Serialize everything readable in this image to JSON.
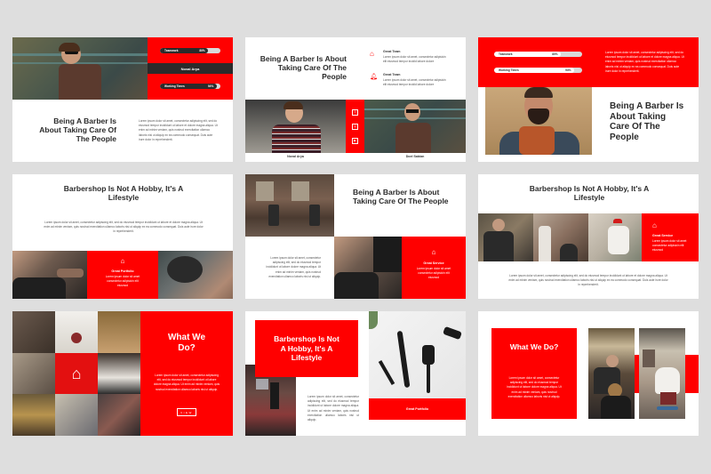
{
  "colors": {
    "accent": "#ff0000",
    "dark": "#2a2a2a",
    "heading": "#2b2b2b",
    "background": "#dedede"
  },
  "lorem": {
    "long": "Lorem ipsum dolor sit amet, consectetur adipiscing elit, sed do eiusmod tempor incididunt ut labore et dolore magna aliqua. Ut enim ad minim veniam, quis nostrud exercitation ullamco laboris nisi ut aliquip ex ea commodo consequat. Duis aute irure dolor in reprehenderit.",
    "medium": "Lorem ipsum dolor sit amet, consectetur adipiscing elit, sed do eiusmod tempor incididunt ut labore dolore magna aliqua. Ut enim ad minim veniam, quis nostrud exercitation ullamco laboris nisi ut aliquip.",
    "short": "Lorem ipsum dolor sit amet consectetur adipisicin elit eiusmod",
    "tiny": "Lorem ipsum dolor sit amet consectetur adipisicin elit eiusmod"
  },
  "slides": [
    {
      "title": "Being A Barber Is About Taking Care Of The People",
      "name_label": "Noval Arya",
      "skills": [
        {
          "label": "Teamwork",
          "percent": 80,
          "percent_text": "80%"
        },
        {
          "label": "Working Times",
          "percent": 94,
          "percent_text": "94%"
        }
      ]
    },
    {
      "title": "Being A Barber Is About Taking Care Of The People",
      "features": [
        {
          "icon": "home-icon",
          "title": "Great Team",
          "text": "Lorem ipsum dolor sit amet, consectetur adipisicin elit eiusmod tempor incidid labore dolore"
        },
        {
          "icon": "bell-icon",
          "title": "Great Team",
          "text": "Lorem ipsum dolor sit amet, consectetur adipisicin elit eiusmod tempor incidid labore dolore"
        }
      ],
      "people": [
        "Noval Arya",
        "Doel Sabian"
      ],
      "social_icons": [
        "twitter-icon",
        "instagram-icon",
        "youtube-icon"
      ]
    },
    {
      "title": "Being A Barber Is About Taking Care Of The People",
      "skills": [
        {
          "label": "Teamwork",
          "percent": 80,
          "percent_text": "80%"
        },
        {
          "label": "Working Times",
          "percent": 94,
          "percent_text": "94%"
        }
      ]
    },
    {
      "title": "Barbershop Is Not A Hobby, It's A Lifestyle",
      "card_title": "Great Portfolio",
      "card_text": "Lorem ipsum dolor sit amet consectetur adipisicin elit eiusmod"
    },
    {
      "title": "Being A Barber Is About Taking Care Of The People",
      "card_title": "Great Service",
      "card_text": "Lorem ipsum dolor sit amet consectetur adipisicin elit eiusmod"
    },
    {
      "title": "Barbershop Is Not A Hobby, It's A Lifestyle",
      "card_title": "Great Service",
      "card_text": "Lorem ipsum dolor sit amet consectetur adipisicin elit eiusmod"
    },
    {
      "title": "What We Do?",
      "button_label": "VIEW"
    },
    {
      "title": "Barbershop Is Not A Hobby, It's A Lifestyle",
      "card_title": "Great Portfolio"
    },
    {
      "title": "What We Do?"
    }
  ]
}
